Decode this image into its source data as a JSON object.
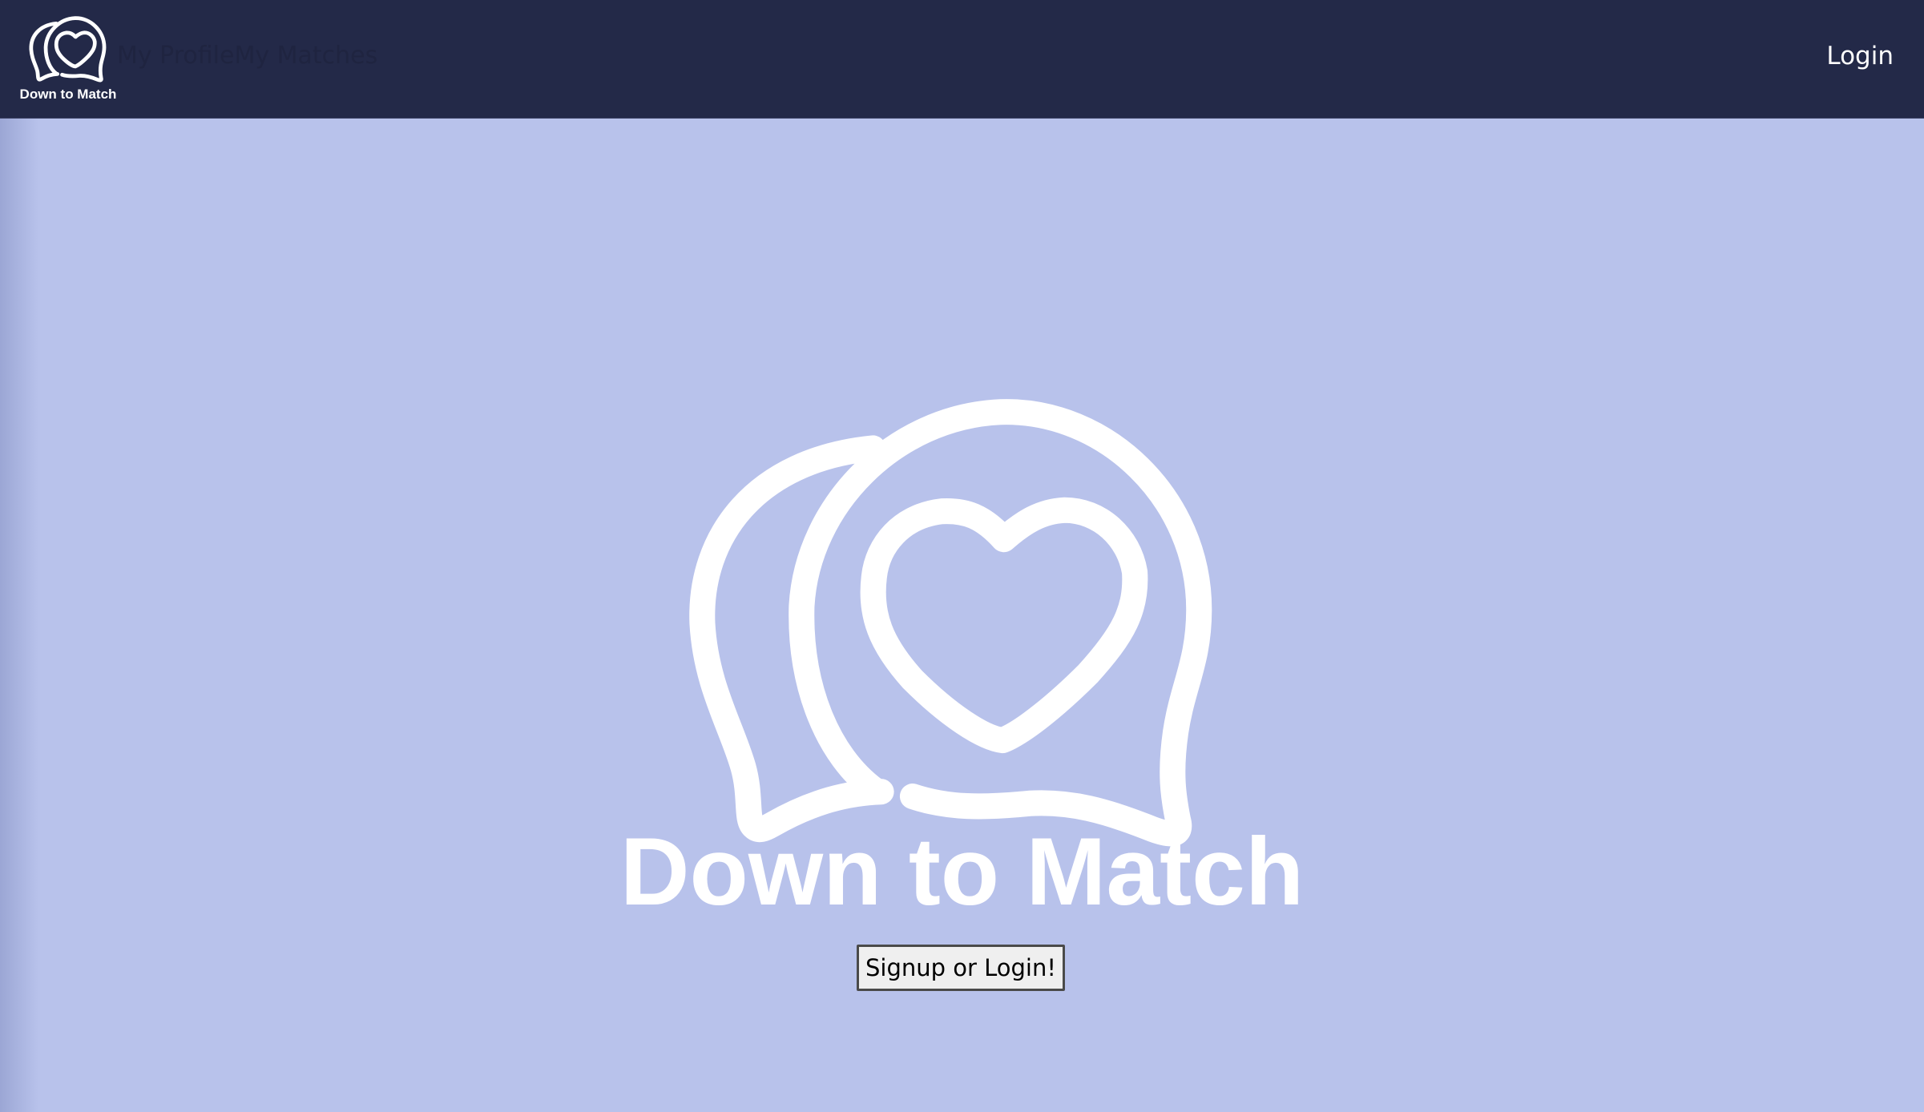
{
  "nav": {
    "brand_name": "Down to Match",
    "links": [
      {
        "label": "My Profile"
      },
      {
        "label": "My Matches"
      }
    ],
    "login_label": "Login"
  },
  "hero": {
    "logo_icon": "chat-bubbles-heart-icon",
    "title": "Down to Match",
    "cta_label": "Signup or Login!"
  },
  "colors": {
    "navbar_bg": "#232948",
    "page_bg": "#b8c2eb",
    "logo_stroke": "#ffffff",
    "nav_link_text": "#1f2440"
  }
}
